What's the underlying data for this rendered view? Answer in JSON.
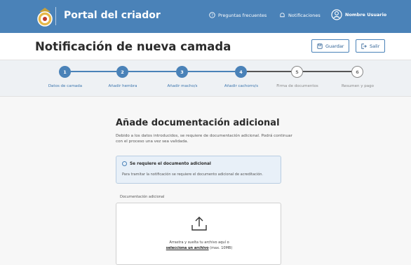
{
  "topbar": {
    "brand": "Portal del criador",
    "faq_label": "Preguntas frecuentes",
    "notifications_label": "Notificaciones",
    "user_label": "Nombre Usuario",
    "bg_color": "#4a82b8"
  },
  "header": {
    "title": "Notificación de nueva camada",
    "save_label": "Guardar",
    "exit_label": "Salir"
  },
  "stepper": {
    "steps": [
      {
        "number": "1",
        "label": "Datos de camada",
        "state": "done"
      },
      {
        "number": "2",
        "label": "Añadir hembra",
        "state": "done"
      },
      {
        "number": "3",
        "label": "Añadir macho/s",
        "state": "done"
      },
      {
        "number": "4",
        "label": "Añadir cachorro/s",
        "state": "done"
      },
      {
        "number": "5",
        "label": "Firma de documentos",
        "state": "todo"
      },
      {
        "number": "6",
        "label": "Resumen y pago",
        "state": "todo"
      }
    ]
  },
  "main": {
    "title": "Añade documentación adicional",
    "description": "Debido a los datos introducidos, se requiere de documentación adicional. Podrá continuar con el proceso una vez sea validada.",
    "info_title": "Se requiere el documento adicional",
    "info_text": "Para tramitar la notificación se requiere el documento adicional de acreditación.",
    "upload_label": "Documentación adicional",
    "drop_text_line1": "Arrastra y suelta tu archivo aquí o",
    "drop_link": "selecciona un archivo",
    "drop_suffix": " (max. 10MB)"
  }
}
